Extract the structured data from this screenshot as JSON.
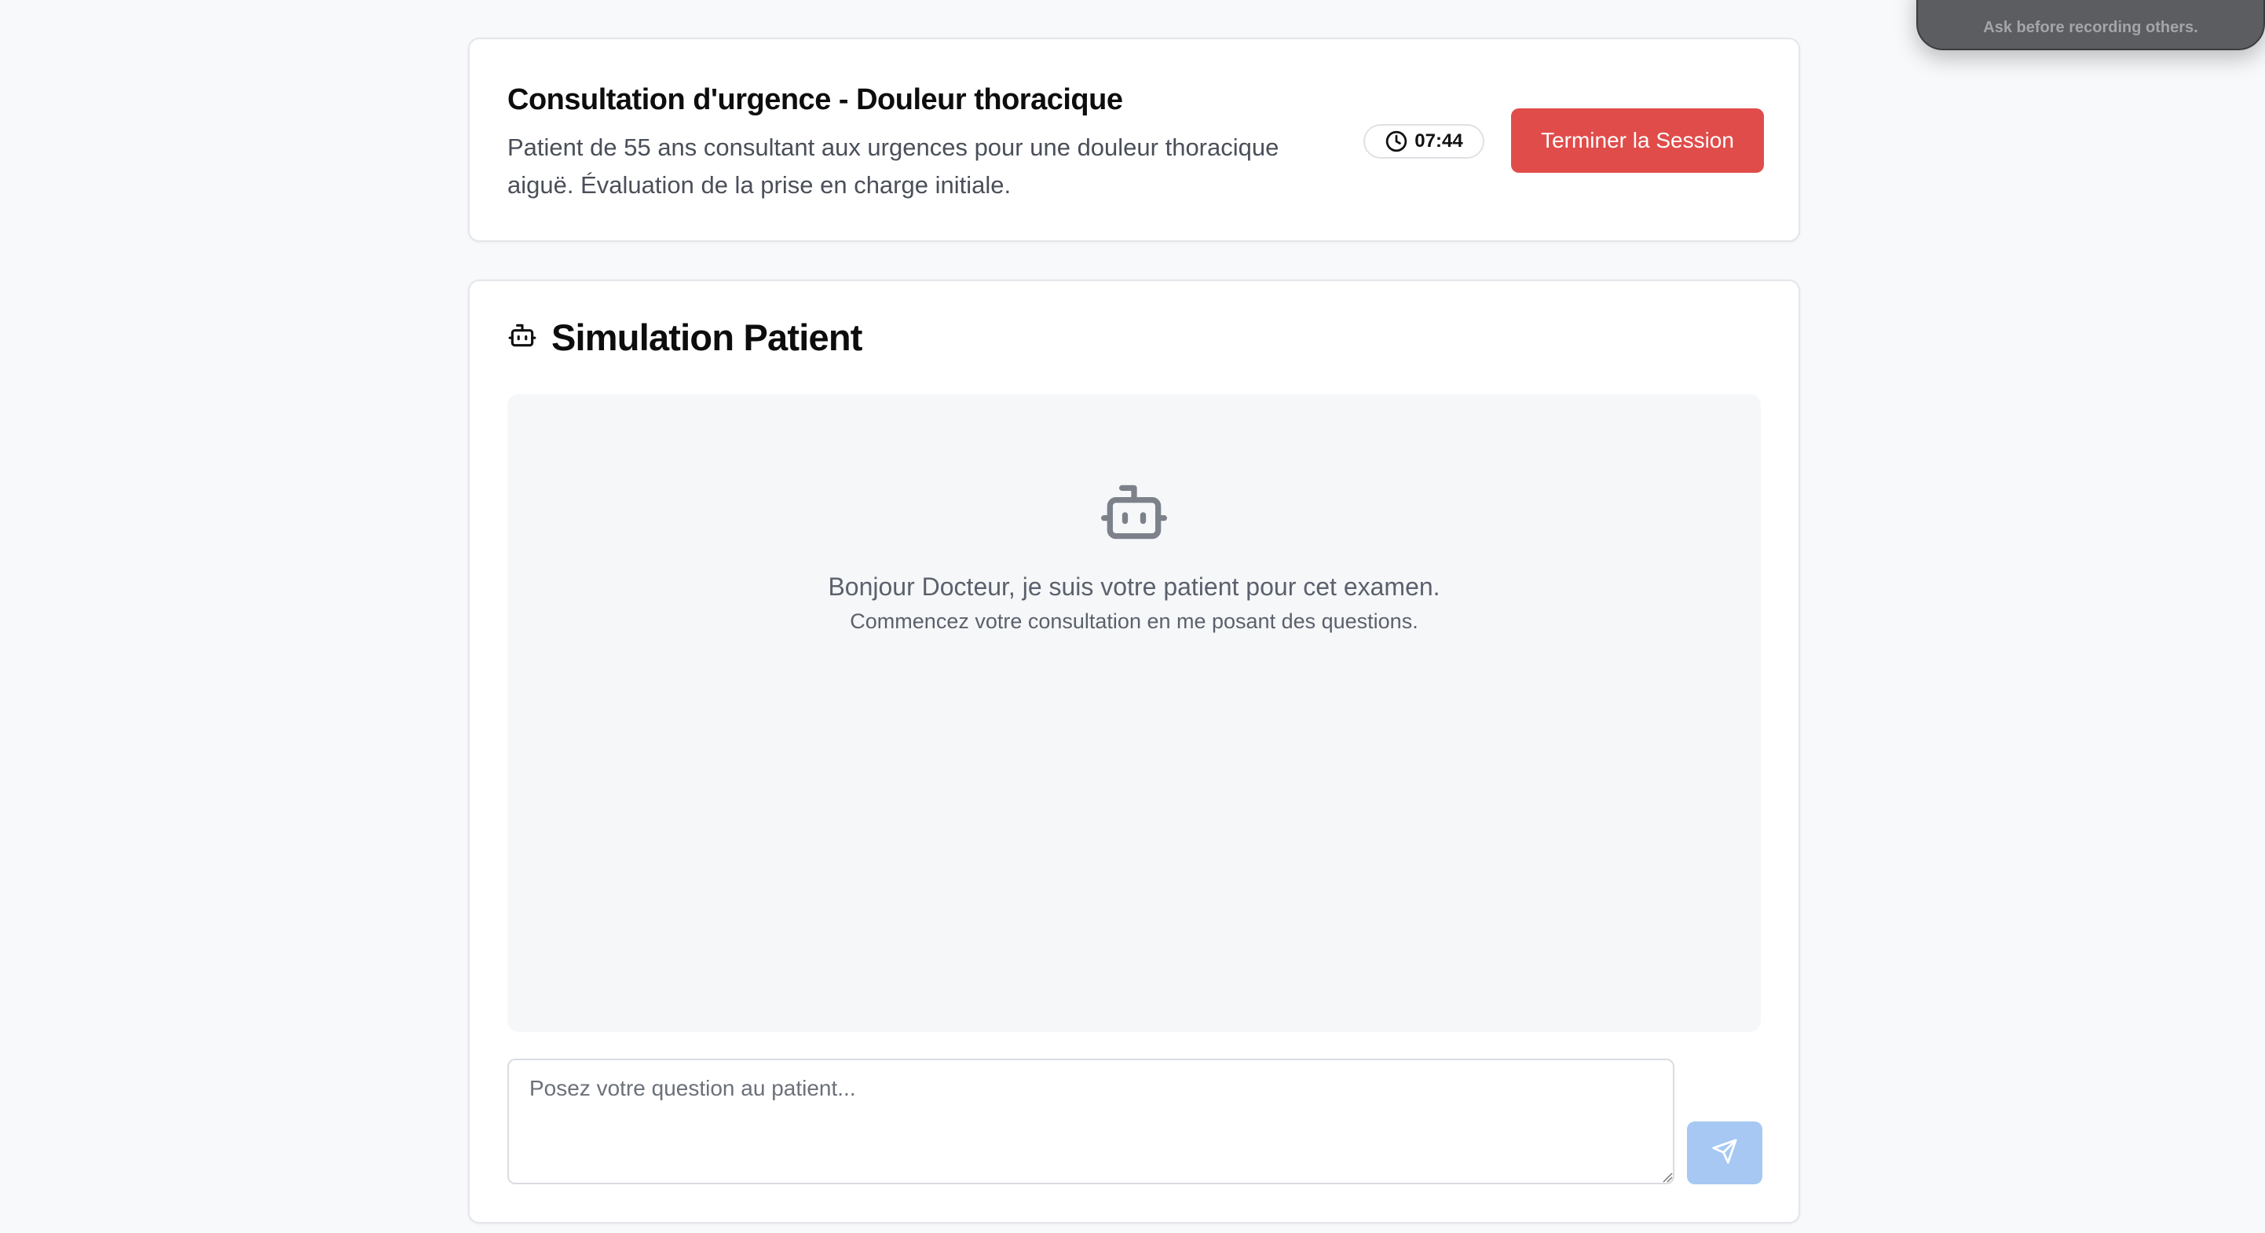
{
  "header": {
    "title": "Consultation d'urgence - Douleur thoracique",
    "description": "Patient de 55 ans consultant aux urgences pour une douleur thoracique aiguë. Évaluation de la prise en charge initiale.",
    "timer": "07:44",
    "end_button_label": "Terminer la Session",
    "icons": {
      "timer": "clock-icon"
    },
    "colors": {
      "end_button": "#e04c4a"
    }
  },
  "simulation": {
    "title": "Simulation Patient",
    "icons": {
      "title": "bot-icon",
      "empty_state": "bot-icon",
      "send": "send-icon"
    },
    "empty_state": {
      "greeting": "Bonjour Docteur, je suis votre patient pour cet examen.",
      "hint": "Commencez votre consultation en me posant des questions."
    },
    "input": {
      "placeholder": "Posez votre question au patient...",
      "value": ""
    },
    "colors": {
      "send_button": "#a6c8f2"
    }
  },
  "overlay": {
    "text": "Ask before recording others."
  }
}
